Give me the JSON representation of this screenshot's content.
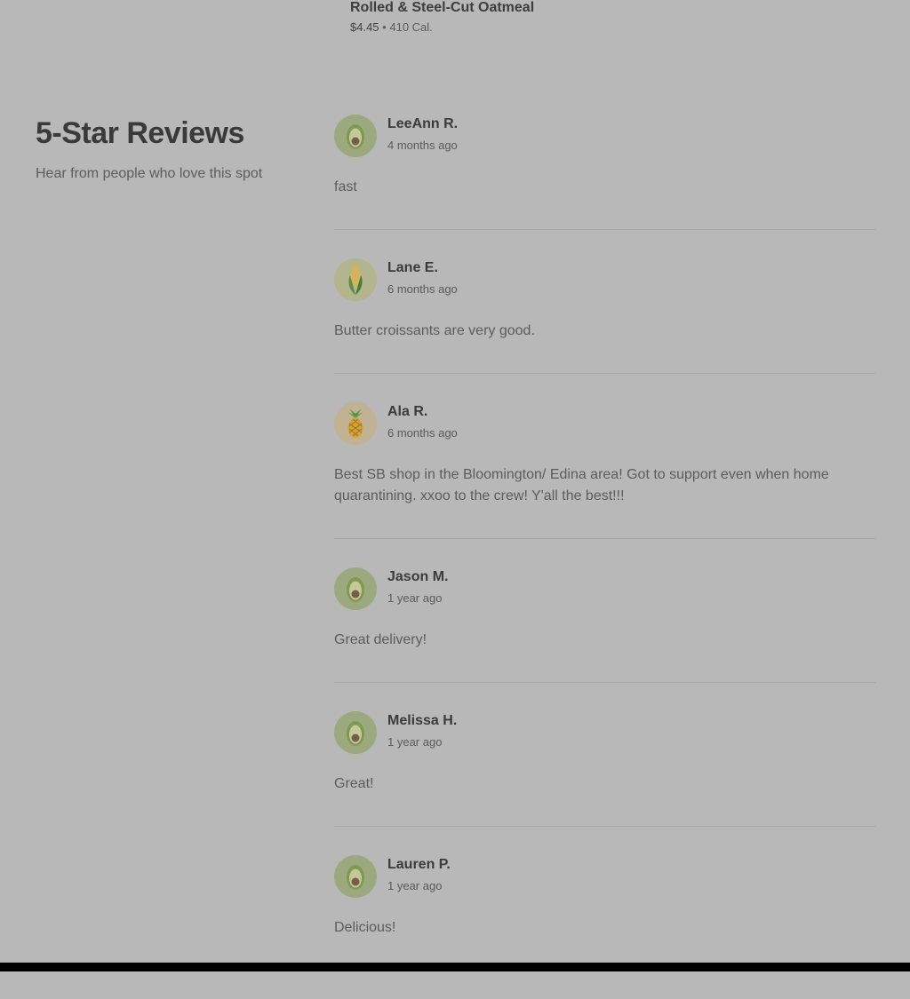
{
  "menu_item": {
    "name": "Rolled & Steel-Cut Oatmeal",
    "price": "$4.45",
    "separator": "•",
    "calories": "410 Cal."
  },
  "reviews_section": {
    "title": "5-Star Reviews",
    "subtitle": "Hear from people who love this spot"
  },
  "colors": {
    "overlay_bg": "#b8b8b8",
    "avocado_bg": "#9ca87e",
    "corn_bg": "#b3b58e",
    "pineapple_bg": "#c1b294",
    "footer": "#000000"
  },
  "reviews": [
    {
      "name": "LeeAnn R.",
      "time": "4 months ago",
      "text": "fast",
      "avatar": "avocado-icon"
    },
    {
      "name": "Lane E.",
      "time": "6 months ago",
      "text": "Butter croissants are very good.",
      "avatar": "corn-icon"
    },
    {
      "name": "Ala R.",
      "time": "6 months ago",
      "text": "Best SB shop in the Bloomington/ Edina area! Got to support even when home quarantining. xxoo to the crew! Y'all the best!!!",
      "avatar": "pineapple-icon"
    },
    {
      "name": "Jason M.",
      "time": "1 year ago",
      "text": "Great delivery!",
      "avatar": "avocado-icon"
    },
    {
      "name": "Melissa H.",
      "time": "1 year ago",
      "text": "Great!",
      "avatar": "avocado-icon"
    },
    {
      "name": "Lauren P.",
      "time": "1 year ago",
      "text": "Delicious!",
      "avatar": "avocado-icon"
    }
  ]
}
